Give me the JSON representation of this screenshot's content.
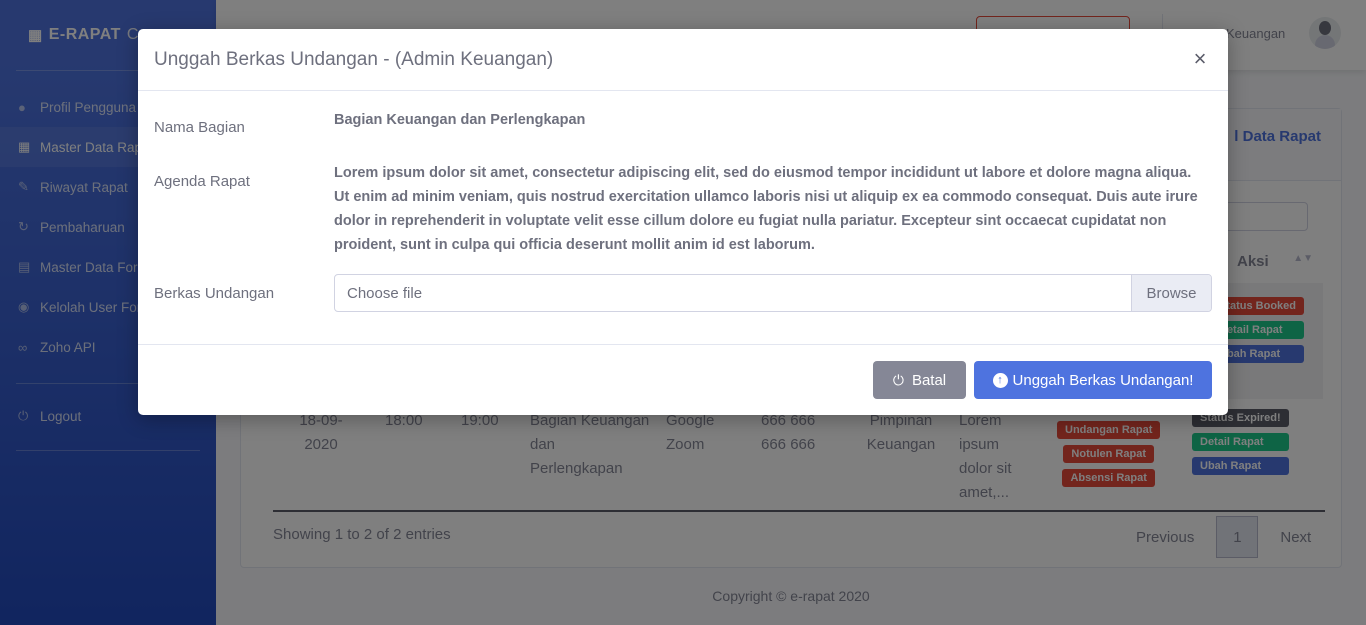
{
  "sidebar": {
    "brand": "E-RAPAT",
    "brand_suffix": "C",
    "items": [
      {
        "label": "Profil Pengguna",
        "icon": "user-icon"
      },
      {
        "label": "Master Data Rapat",
        "icon": "calendar-icon"
      },
      {
        "label": "Riwayat Rapat",
        "icon": "edit-icon"
      },
      {
        "label": "Pembaharuan",
        "icon": "sync-icon"
      },
      {
        "label": "Master Data Form",
        "icon": "file-icon"
      },
      {
        "label": "Kelolah User Form",
        "icon": "user-circle-icon"
      },
      {
        "label": "Zoho API",
        "icon": "link-icon"
      }
    ],
    "logout": "Logout"
  },
  "topbar": {
    "user": "Keuangan"
  },
  "card": {
    "title": "l Data Rapat",
    "th_aksi": "Aksi"
  },
  "row": {
    "date": "18-09-2020",
    "start": "18:00",
    "end": "19:00",
    "bagian": "Bagian Keuangan dan Perlengkapan",
    "media": "Google Zoom",
    "id": "666 666 666 666",
    "pimpinan": "Pimpinan Keuangan",
    "agenda_short": "Lorem ipsum dolor sit amet,...",
    "badges_mid": [
      "Undangan Rapat",
      "Notulen Rapat",
      "Absensi Rapat"
    ],
    "badges_row1": [
      "Status Booked",
      "Detail Rapat",
      "Ubah Rapat"
    ],
    "badges_row2": [
      "Status Expired!",
      "Detail Rapat",
      "Ubah Rapat"
    ]
  },
  "table_info": "Showing 1 to 2 of 2 entries",
  "pager": {
    "prev": "Previous",
    "page": "1",
    "next": "Next"
  },
  "footer": "Copyright © e-rapat 2020",
  "modal": {
    "title": "Unggah Berkas Undangan - (Admin Keuangan)",
    "close": "×",
    "nama_label": "Nama Bagian",
    "nama_value": "Bagian Keuangan dan Perlengkapan",
    "agenda_label": "Agenda Rapat",
    "agenda_value": "Lorem ipsum dolor sit amet, consectetur adipiscing elit, sed do eiusmod tempor incididunt ut labore et dolore magna aliqua. Ut enim ad minim veniam, quis nostrud exercitation ullamco laboris nisi ut aliquip ex ea commodo consequat. Duis aute irure dolor in reprehenderit in voluptate velit esse cillum dolore eu fugiat nulla pariatur. Excepteur sint occaecat cupidatat non proident, sunt in culpa qui officia deserunt mollit anim id est laborum.",
    "berkas_label": "Berkas Undangan",
    "file_placeholder": "Choose file",
    "browse": "Browse",
    "cancel": "Batal",
    "upload": "Unggah Berkas Undangan!"
  }
}
